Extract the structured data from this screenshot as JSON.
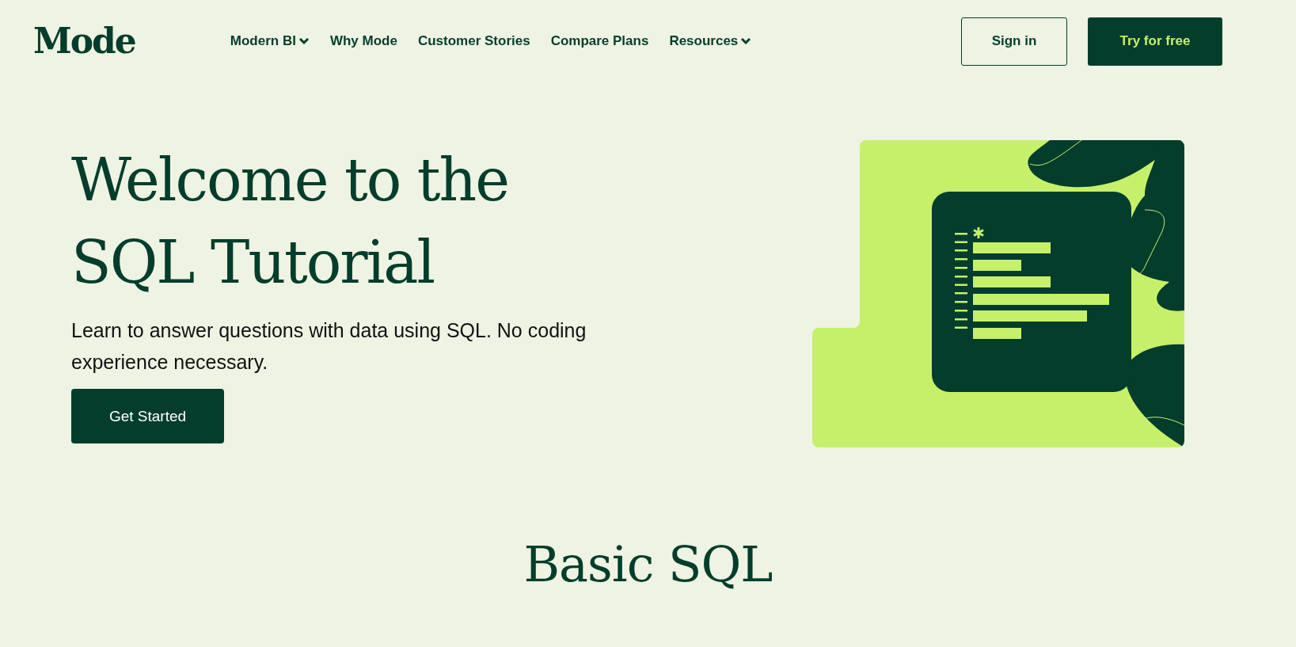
{
  "header": {
    "logo": "Mode",
    "nav": [
      {
        "label": "Modern BI",
        "has_menu": true
      },
      {
        "label": "Why Mode",
        "has_menu": false
      },
      {
        "label": "Customer Stories",
        "has_menu": false
      },
      {
        "label": "Compare Plans",
        "has_menu": false
      },
      {
        "label": "Resources",
        "has_menu": true
      }
    ],
    "buttons": [
      {
        "label": "Sign in",
        "kind": "outline"
      },
      {
        "label": "Try for free",
        "kind": "primary"
      }
    ]
  },
  "hero": {
    "title_lines": [
      "Welcome to the",
      "SQL Tutorial"
    ],
    "subtitle": "Learn to answer questions with data using SQL. No coding experience necessary.",
    "button": "Get Started"
  },
  "section": {
    "title": "Basic SQL"
  }
}
